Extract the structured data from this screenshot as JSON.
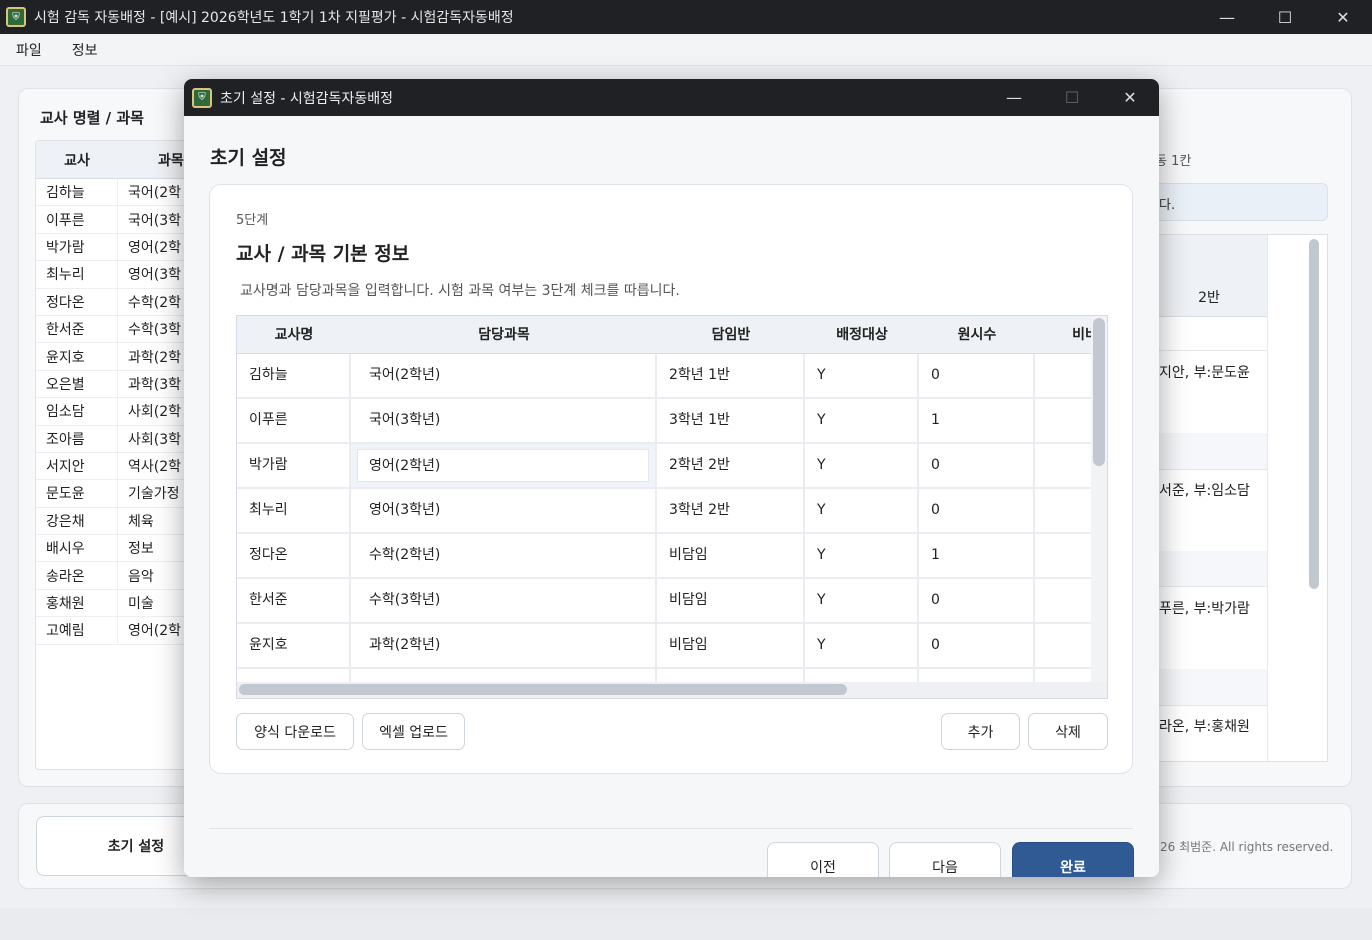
{
  "window": {
    "title": "시험 감독 자동배정 - [예시] 2026학년도 1학기 1차 지필평가 - 시험감독자동배정",
    "minimize": "—",
    "maximize": "☐",
    "close": "✕"
  },
  "menu": [
    "파일",
    "정보"
  ],
  "background": {
    "heading": "교사 명렬 / 과목",
    "table_headers": [
      "교사",
      "과목"
    ],
    "rows": [
      {
        "teacher": "김하늘",
        "subject": "국어(2학"
      },
      {
        "teacher": "이푸른",
        "subject": "국어(3학"
      },
      {
        "teacher": "박가람",
        "subject": "영어(2학"
      },
      {
        "teacher": "최누리",
        "subject": "영어(3학"
      },
      {
        "teacher": "정다온",
        "subject": "수학(2학"
      },
      {
        "teacher": "한서준",
        "subject": "수학(3학"
      },
      {
        "teacher": "윤지호",
        "subject": "과학(2학"
      },
      {
        "teacher": "오은별",
        "subject": "과학(3학"
      },
      {
        "teacher": "임소담",
        "subject": "사회(2학"
      },
      {
        "teacher": "조아름",
        "subject": "사회(3학"
      },
      {
        "teacher": "서지안",
        "subject": "역사(2학"
      },
      {
        "teacher": "문도윤",
        "subject": "기술가정"
      },
      {
        "teacher": "강은채",
        "subject": "체육"
      },
      {
        "teacher": "배시우",
        "subject": "정보"
      },
      {
        "teacher": "송라온",
        "subject": "음악"
      },
      {
        "teacher": "홍채원",
        "subject": "미술"
      },
      {
        "teacher": "고예림",
        "subject": "영어(2학"
      }
    ],
    "right_note": "동 1칸",
    "right_box": "다.",
    "right_header": "2반",
    "right_cells": [
      "지안, 부:문도윤",
      "서준, 부:임소담",
      "푸른, 부:박가람",
      "라온, 부:홍채원"
    ],
    "bottom_button": "초기 설정",
    "copyright": "26 최범준. All rights reserved."
  },
  "dialog": {
    "title": "초기 설정 - 시험감독자동배정",
    "heading": "초기 설정",
    "step": "5단계",
    "card_title": "교사 / 과목 기본 정보",
    "description": "교사명과 담당과목을 입력합니다. 시험 과목 여부는 3단계 체크를 따릅니다.",
    "columns": [
      "교사명",
      "담당과목",
      "담임반",
      "배정대상",
      "원시수",
      "비비"
    ],
    "rows": [
      {
        "name": "김하늘",
        "subject": "국어(2학년)",
        "homeroom": "2학년 1반",
        "target": "Y",
        "hours": "0"
      },
      {
        "name": "이푸른",
        "subject": "국어(3학년)",
        "homeroom": "3학년 1반",
        "target": "Y",
        "hours": "1"
      },
      {
        "name": "박가람",
        "subject": "영어(2학년)",
        "homeroom": "2학년 2반",
        "target": "Y",
        "hours": "0"
      },
      {
        "name": "최누리",
        "subject": "영어(3학년)",
        "homeroom": "3학년 2반",
        "target": "Y",
        "hours": "0"
      },
      {
        "name": "정다온",
        "subject": "수학(2학년)",
        "homeroom": "비담임",
        "target": "Y",
        "hours": "1"
      },
      {
        "name": "한서준",
        "subject": "수학(3학년)",
        "homeroom": "비담임",
        "target": "Y",
        "hours": "0"
      },
      {
        "name": "윤지호",
        "subject": "과학(2학년)",
        "homeroom": "비담임",
        "target": "Y",
        "hours": "0"
      }
    ],
    "buttons": {
      "template_download": "양식 다운로드",
      "excel_upload": "엑셀 업로드",
      "add": "추가",
      "delete": "삭제",
      "prev": "이전",
      "next": "다음",
      "finish": "완료"
    }
  }
}
